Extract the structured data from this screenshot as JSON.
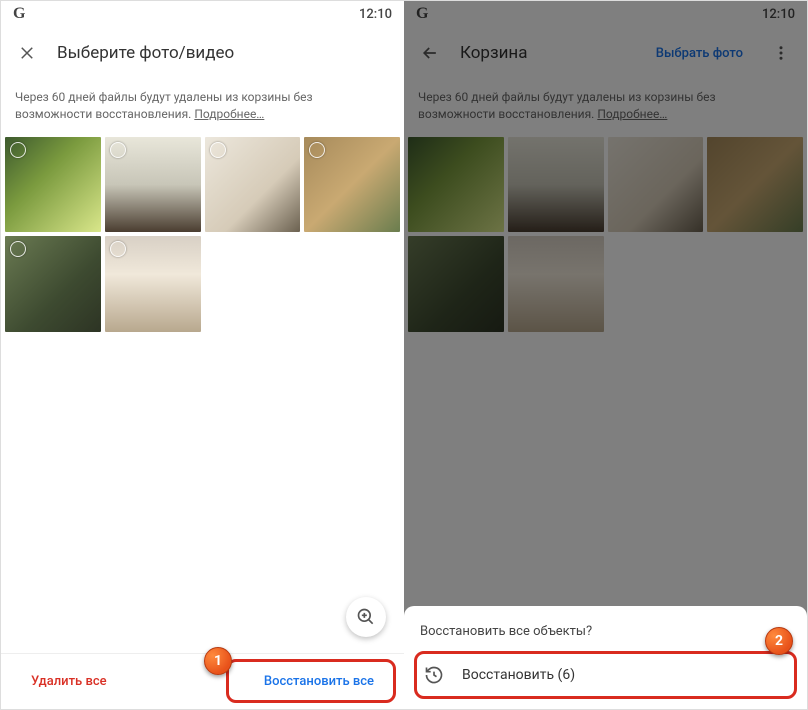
{
  "left": {
    "status": {
      "logo": "G",
      "time": "12:10"
    },
    "appbar": {
      "title": "Выберите фото/видео"
    },
    "banner": {
      "text": "Через 60 дней файлы будут удалены из корзины без возможности восстановления. ",
      "link": "Подробнее…"
    },
    "bottom": {
      "delete": "Удалить все",
      "restore": "Восстановить все"
    },
    "callout": "1"
  },
  "right": {
    "status": {
      "logo": "G",
      "time": "12:10"
    },
    "appbar": {
      "title": "Корзина",
      "action": "Выбрать фото"
    },
    "banner": {
      "text": "Через 60 дней файлы будут удалены из корзины без возможности восстановления. ",
      "link": "Подробнее…"
    },
    "sheet": {
      "title": "Восстановить все объекты?",
      "action": "Восстановить (6)"
    },
    "callout": "2"
  }
}
